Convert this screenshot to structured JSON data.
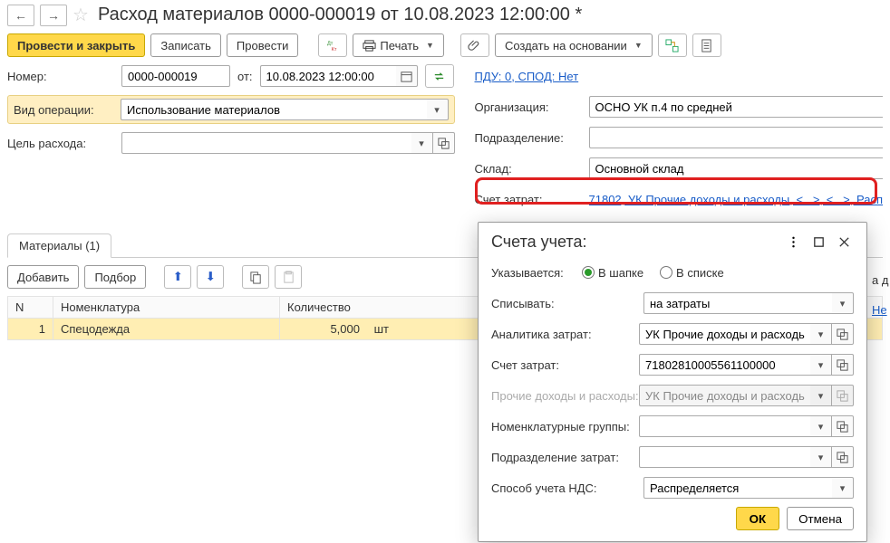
{
  "title": "Расход материалов 0000-000019 от 10.08.2023 12:00:00 *",
  "toolbar": {
    "postClose": "Провести и закрыть",
    "record": "Записать",
    "post": "Провести",
    "print": "Печать",
    "createBasedOn": "Создать на основании"
  },
  "header": {
    "numberLabel": "Номер:",
    "number": "0000-000019",
    "dateLabel": "от:",
    "date": "10.08.2023 12:00:00",
    "pduLink": "ПДУ: 0, СПОД: Нет",
    "opTypeLabel": "Вид операции:",
    "opType": "Использование материалов",
    "purposeLabel": "Цель расхода:",
    "purpose": "",
    "orgLabel": "Организация:",
    "org": "ОСНО УК п.4 по средней",
    "divLabel": "Подразделение:",
    "div": "",
    "whLabel": "Склад:",
    "wh": "Основной склад",
    "costAcctLabel": "Счет затрат:",
    "costAcctLink": "71802, УК Прочие доходы и расходы, <...>, <...>, Расп"
  },
  "tabs": {
    "materials": "Материалы (1)"
  },
  "matToolbar": {
    "add": "Добавить",
    "select": "Подбор"
  },
  "table": {
    "cols": {
      "n": "N",
      "nom": "Номенклатура",
      "qty": "Количество"
    },
    "rows": [
      {
        "n": "1",
        "nom": "Спецодежда",
        "qty": "5,000",
        "unit": "шт"
      }
    ]
  },
  "behind": {
    "headerTail": "а д",
    "linkTail": "Не"
  },
  "popup": {
    "title": "Счета учета:",
    "specLabel": "Указывается:",
    "radioHeader": "В шапке",
    "radioList": "В списке",
    "writeOffLabel": "Списывать:",
    "writeOff": "на затраты",
    "analyticsLabel": "Аналитика затрат:",
    "analytics": "УК Прочие доходы и расходы",
    "acctLabel": "Счет затрат:",
    "acct": "71802810005561100000",
    "otherLabel": "Прочие доходы и расходы:",
    "other": "УК Прочие доходы и расходы",
    "nomGroupLabel": "Номенклатурные группы:",
    "nomGroup": "",
    "costDivLabel": "Подразделение затрат:",
    "costDiv": "",
    "vatLabel": "Способ учета НДС:",
    "vat": "Распределяется",
    "ok": "ОК",
    "cancel": "Отмена"
  }
}
